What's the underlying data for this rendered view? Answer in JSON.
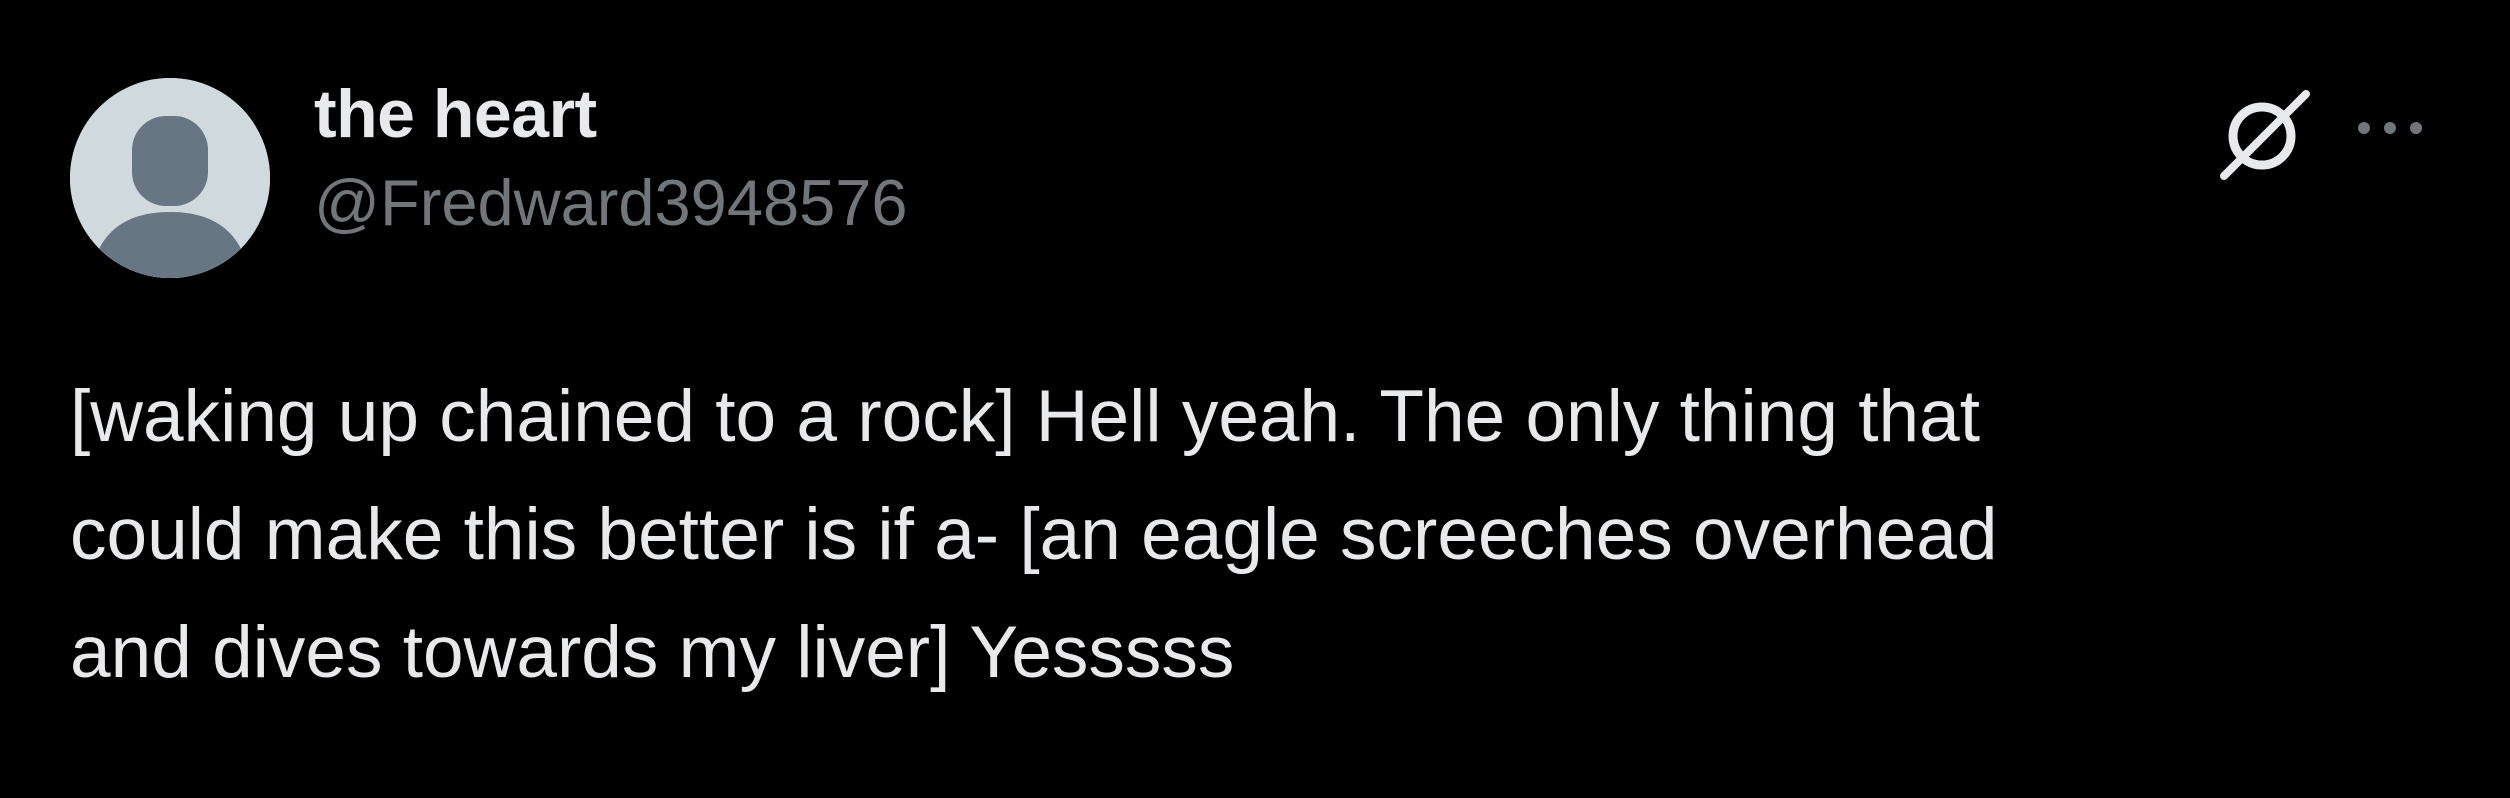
{
  "tweet": {
    "author": {
      "display_name": "the heart",
      "handle": "@Fredward3948576",
      "avatar": "default-avatar-icon"
    },
    "actions": {
      "grok_icon": "grok-icon",
      "more_icon": "more-options-icon"
    },
    "text_lines": [
      "[waking up chained to a rock] Hell yeah. The only thing that",
      "could make this better is if a- [an eagle screeches overhead",
      "and dives towards my liver] Yesssss"
    ]
  },
  "colors": {
    "background": "#000000",
    "primary_text": "#e7e9ea",
    "secondary_text": "#71767b",
    "avatar_bg": "#cfd9de",
    "avatar_figure": "#687684"
  }
}
